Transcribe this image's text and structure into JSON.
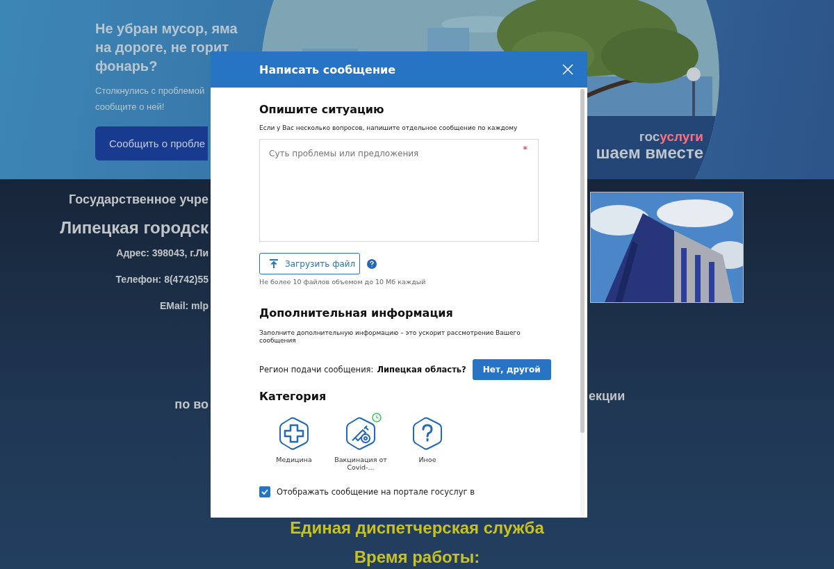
{
  "hero": {
    "heading": "Не убран мусор, яма на дороге, не горит фонарь?",
    "text_lines": [
      "Столкнулись с проблемой",
      "сообщите о ней!"
    ],
    "button": "Сообщить о пробле",
    "logo": {
      "part_1": "гос",
      "part_2": "услуги"
    },
    "slogan": "шаем вместе"
  },
  "footer": {
    "lines": [
      {
        "kind": "subtitle",
        "text": "Государственное учре"
      },
      {
        "kind": "title",
        "text": "Липецкая городск"
      },
      {
        "kind": "info",
        "text": "Адрес: 398043, г.Ли"
      },
      {
        "kind": "info",
        "text": "Телефон: 8(4742)55"
      },
      {
        "kind": "info",
        "text": "EMail: mlp"
      }
    ],
    "topic_left": "по во",
    "topic_right": "екции",
    "service": "Единая диспетчерская служба",
    "hours_title": "Время работы:"
  },
  "dialog": {
    "title": "Написать сообщение",
    "describe": {
      "heading": "Опишите ситуацию",
      "hint": "Если у Вас несколько вопросов, напишите отдельное сообщение по каждому",
      "placeholder": "Суть проблемы или предложения",
      "required_mark": "*",
      "upload_button": "Загрузить файл",
      "upload_note": "Не более 10 файлов объемом до 10 Мб каждый"
    },
    "extra": {
      "heading": "Дополнительная информация",
      "hint": "Заполните дополнительную информацию – это ускорит рассмотрение Вашего сообщения",
      "region_label": "Регион подачи сообщения:",
      "region_value": "Липецкая область?",
      "region_button": "Нет, другой"
    },
    "category": {
      "heading": "Категория",
      "items": [
        {
          "kind": "medicine",
          "label": "Медицина",
          "timer_badge": false
        },
        {
          "kind": "vaccine",
          "label": "Вакцинация от Covid-...",
          "timer_badge": true
        },
        {
          "kind": "other",
          "label": "Иное",
          "timer_badge": false
        }
      ]
    },
    "show_on_portal": {
      "label": "Отображать сообщение на портале госуслуг в",
      "checked": true
    }
  }
}
